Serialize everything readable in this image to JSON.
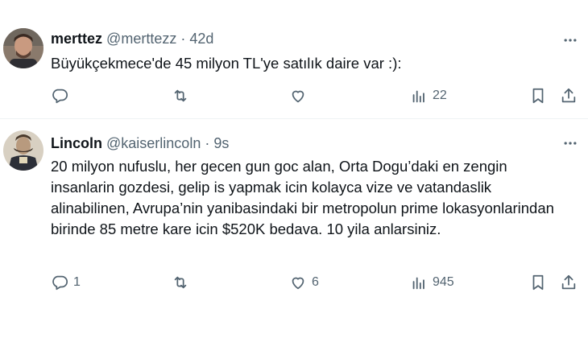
{
  "tweets": [
    {
      "name": "merttez",
      "handle": "@merttezz",
      "time": "42d",
      "text": "Büyükçekmece'de 45 milyon TL'ye satılık daire var :):",
      "replies": "",
      "retweets": "",
      "likes": "",
      "views": "22"
    },
    {
      "name": "Lincoln",
      "handle": "@kaiserlincoln",
      "time": "9s",
      "text": "20 milyon nufuslu, her gecen gun goc alan, Orta Dogu’daki en zengin insanlarin gozdesi, gelip is yapmak icin kolayca vize ve vatandaslik alinabilinen, Avrupa’nin yanibasindaki bir metropolun prime lokasyonlarindan birinde 85 metre kare icin $520K bedava. 10 yila anlarsiniz.",
      "replies": "1",
      "retweets": "",
      "likes": "6",
      "views": "945"
    }
  ],
  "separator": "·",
  "icons": [
    "more-icon",
    "reply-icon",
    "retweet-icon",
    "like-icon",
    "views-icon",
    "bookmark-icon",
    "share-icon"
  ],
  "colors": {
    "text": "#0f1419",
    "muted": "#536471",
    "divider": "#eff3f4"
  }
}
